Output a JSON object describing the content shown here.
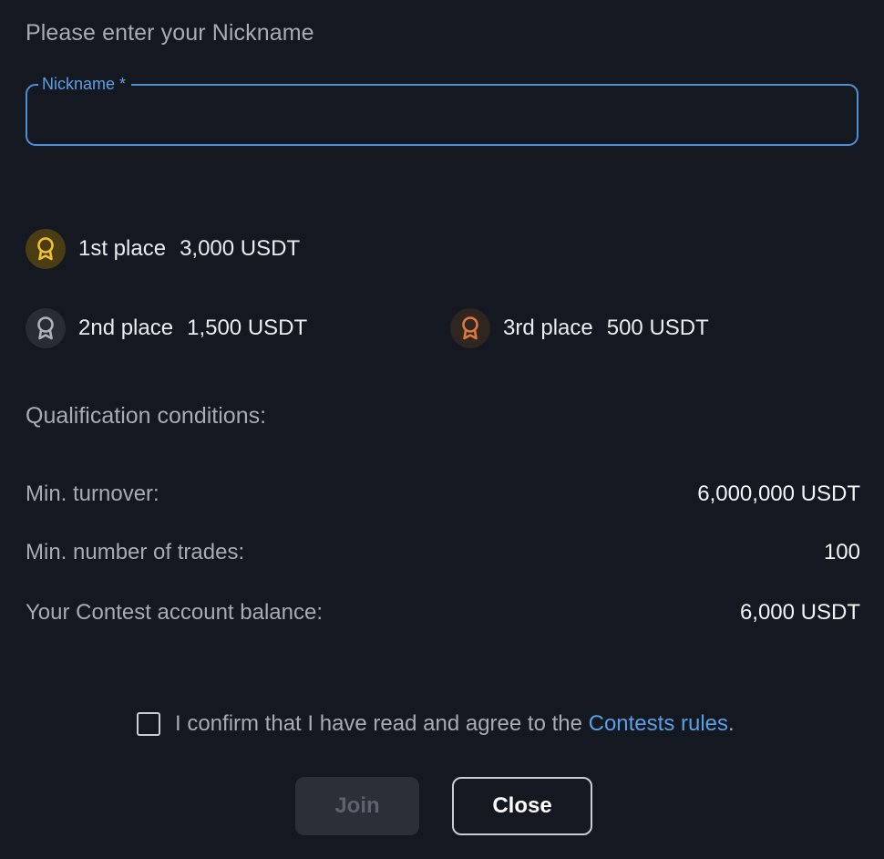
{
  "form": {
    "prompt": "Please enter your Nickname",
    "nickname_label": "Nickname *",
    "nickname_value": ""
  },
  "prizes": {
    "first": {
      "label": "1st place",
      "value": "3,000 USDT",
      "medal_color": "#f2c12e"
    },
    "second": {
      "label": "2nd place",
      "value": "1,500 USDT",
      "medal_color": "#aeb3bb"
    },
    "third": {
      "label": "3rd place",
      "value": "500 USDT",
      "medal_color": "#e0783c"
    }
  },
  "qualification": {
    "title": "Qualification conditions:",
    "rows": [
      {
        "label": "Min. turnover:",
        "value": "6,000,000 USDT"
      },
      {
        "label": "Min. number of trades:",
        "value": "100"
      },
      {
        "label": "Your Contest account balance:",
        "value": "6,000 USDT"
      }
    ]
  },
  "confirm": {
    "checked": false,
    "text": "I confirm that I have read and agree to the ",
    "link": "Contests rules",
    "suffix": "."
  },
  "buttons": {
    "join": "Join",
    "close": "Close"
  },
  "colors": {
    "background": "#141821",
    "accent": "#5b9ee6",
    "field_border": "#4d8fd6"
  }
}
